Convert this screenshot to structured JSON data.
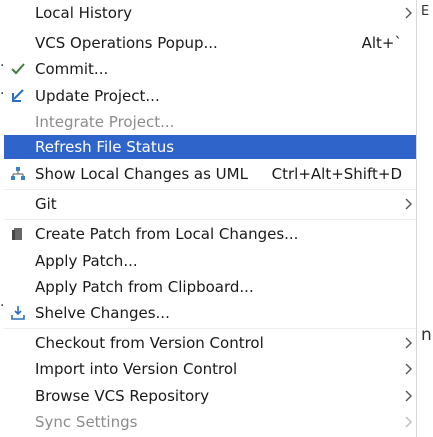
{
  "menu": {
    "items": [
      {
        "label": "Local History",
        "submenu": true
      },
      {
        "label": "VCS Operations Popup...",
        "shortcut": "Alt+`"
      },
      {
        "label": "Commit...",
        "icon": "check-icon"
      },
      {
        "label": "Update Project...",
        "icon": "update-arrow-icon"
      },
      {
        "label": "Integrate Project...",
        "disabled": true
      },
      {
        "label": "Refresh File Status",
        "selected": true
      },
      {
        "label": "Show Local Changes as UML",
        "shortcut": "Ctrl+Alt+Shift+D",
        "icon": "uml-diagram-icon"
      },
      {
        "label": "Git",
        "submenu": true
      },
      {
        "label": "Create Patch from Local Changes...",
        "icon": "patch-icon"
      },
      {
        "label": "Apply Patch..."
      },
      {
        "label": "Apply Patch from Clipboard..."
      },
      {
        "label": "Shelve Changes...",
        "icon": "shelve-icon"
      },
      {
        "label": "Checkout from Version Control",
        "submenu": true
      },
      {
        "label": "Import into Version Control",
        "submenu": true
      },
      {
        "label": "Browse VCS Repository",
        "submenu": true
      },
      {
        "label": "Sync Settings",
        "submenu": true,
        "disabled": true
      }
    ]
  },
  "background": {
    "right_letters": [
      "E",
      "n"
    ]
  },
  "colors": {
    "selection": "#2f65ca",
    "check": "#3d7d3d",
    "update": "#2a6fc0",
    "disabled_text": "#8c8c8c"
  }
}
